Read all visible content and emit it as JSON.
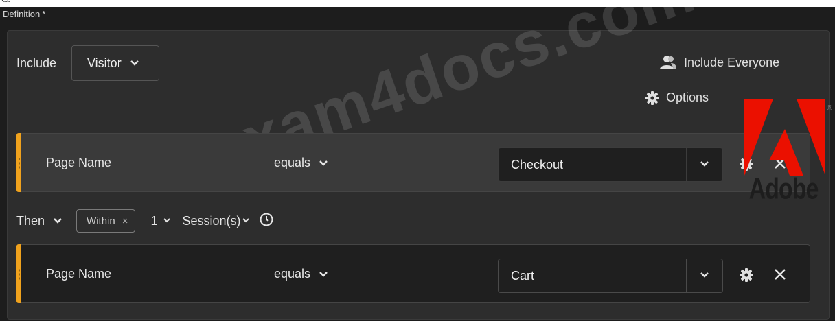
{
  "top_glyph": "C.",
  "definition": {
    "label": "Definition",
    "required_mark": "*"
  },
  "include": {
    "label": "Include",
    "container": "Visitor"
  },
  "actions": {
    "include_everyone": "Include Everyone",
    "options": "Options"
  },
  "rules": [
    {
      "dimension": "Page Name",
      "operator": "equals",
      "value": "Checkout"
    },
    {
      "dimension": "Page Name",
      "operator": "equals",
      "value": "Cart"
    }
  ],
  "sequence": {
    "operator": "Then",
    "constraint": "Within",
    "constraint_remove": "×",
    "count": "1",
    "unit": "Session(s)"
  },
  "watermark": "exam4docs.com",
  "logo": {
    "word": "Adobe",
    "registered": "®"
  },
  "colors": {
    "accent_bar": "#f0a21d",
    "logo_red": "#eb1000",
    "background": "#2d2d2d"
  },
  "icons": [
    "users-icon",
    "gear-icon",
    "chevron-down-icon",
    "close-icon",
    "clock-icon",
    "adobe-logo"
  ]
}
